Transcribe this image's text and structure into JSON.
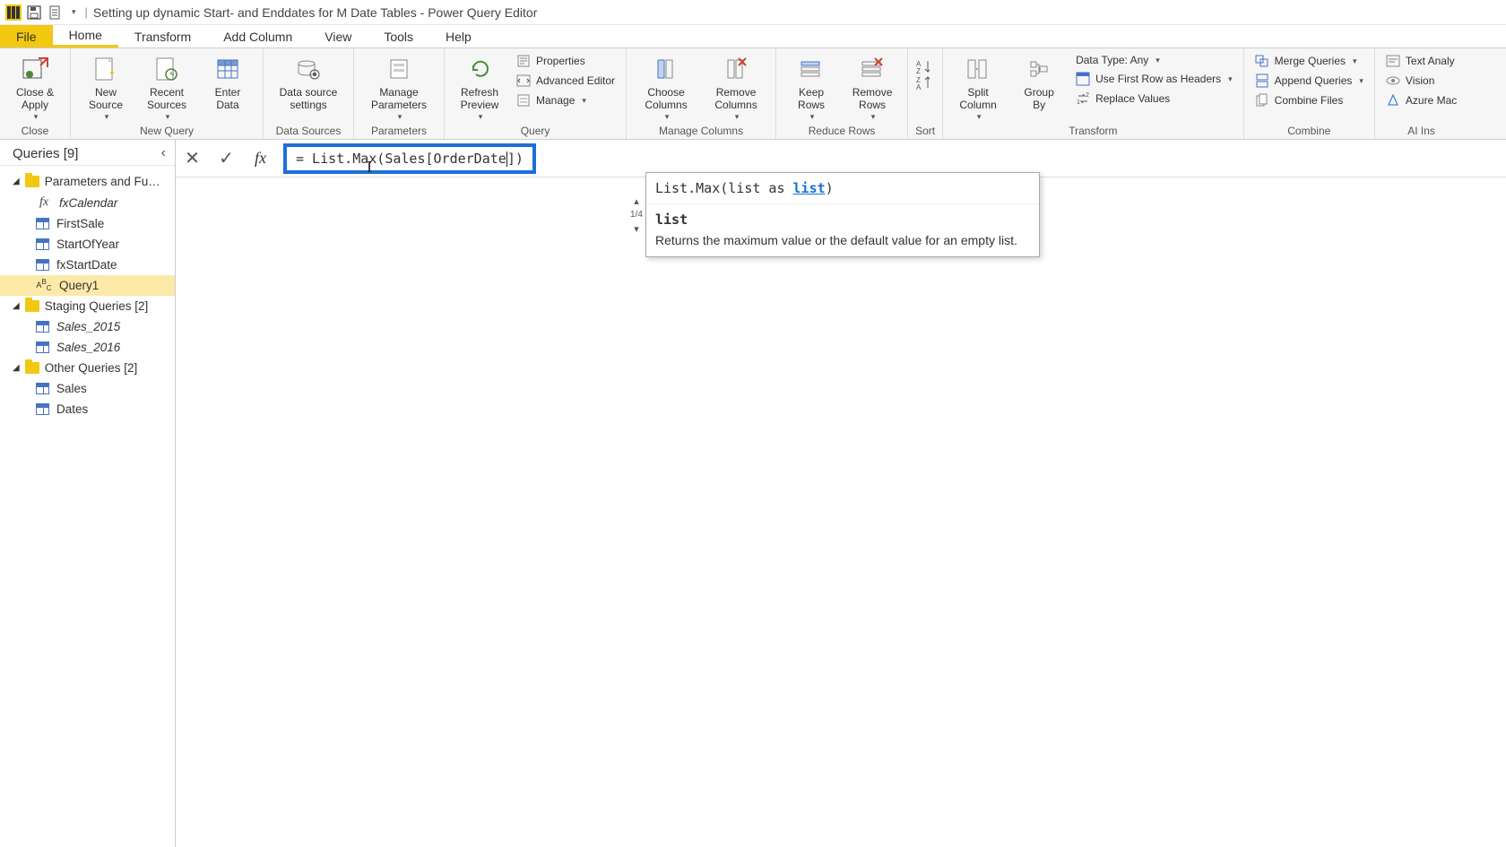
{
  "title_bar": {
    "title": "Setting up dynamic Start- and Enddates for M Date Tables - Power Query Editor"
  },
  "tabs": {
    "file": "File",
    "home": "Home",
    "transform": "Transform",
    "add_column": "Add Column",
    "view": "View",
    "tools": "Tools",
    "help": "Help"
  },
  "ribbon": {
    "close": {
      "close_apply": "Close &\nApply",
      "group": "Close"
    },
    "new_query": {
      "new_source": "New\nSource",
      "recent_sources": "Recent\nSources",
      "enter_data": "Enter\nData",
      "group": "New Query"
    },
    "data_sources": {
      "settings": "Data source\nsettings",
      "group": "Data Sources"
    },
    "parameters": {
      "manage": "Manage\nParameters",
      "group": "Parameters"
    },
    "query": {
      "refresh": "Refresh\nPreview",
      "properties": "Properties",
      "advanced": "Advanced Editor",
      "manage": "Manage",
      "group": "Query"
    },
    "manage_columns": {
      "choose": "Choose\nColumns",
      "remove": "Remove\nColumns",
      "group": "Manage Columns"
    },
    "reduce_rows": {
      "keep": "Keep\nRows",
      "remove": "Remove\nRows",
      "group": "Reduce Rows"
    },
    "sort": {
      "group": "Sort"
    },
    "transform": {
      "split": "Split\nColumn",
      "group_by": "Group\nBy",
      "data_type": "Data Type: Any",
      "first_row": "Use First Row as Headers",
      "replace": "Replace Values",
      "group": "Transform"
    },
    "combine": {
      "merge": "Merge Queries",
      "append": "Append Queries",
      "combine_files": "Combine Files",
      "group": "Combine"
    },
    "ai": {
      "text": "Text Analy",
      "vision": "Vision",
      "azure": "Azure Mac",
      "group": "AI Ins"
    }
  },
  "queries_panel": {
    "header": "Queries [9]",
    "groups": {
      "params": "Parameters and Fu…",
      "staging": "Staging Queries [2]",
      "other": "Other Queries [2]"
    },
    "items": {
      "fxCalendar": "fxCalendar",
      "FirstSale": "FirstSale",
      "StartOfYear": "StartOfYear",
      "fxStartDate": "fxStartDate",
      "Query1": "Query1",
      "Sales_2015": "Sales_2015",
      "Sales_2016": "Sales_2016",
      "Sales": "Sales",
      "Dates": "Dates"
    }
  },
  "formula_bar": {
    "fx": "fx",
    "prefix": "= List.Max(Sales[OrderDat",
    "suffix_inside": "e",
    "closing": "])"
  },
  "intellisense": {
    "sig_pre": "List.Max(list as ",
    "sig_list": "list",
    "sig_post": ")",
    "param": "list",
    "desc": "Returns the maximum value or the default value for an empty list.",
    "counter": "1/4"
  }
}
